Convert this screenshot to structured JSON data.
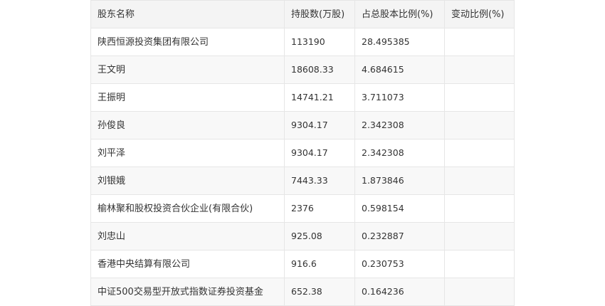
{
  "table": {
    "headers": [
      "股东名称",
      "持股数(万股)",
      "占总股本比例(%)",
      "变动比例(%)"
    ],
    "rows": [
      [
        "陕西恒源投资集团有限公司",
        "113190",
        "28.495385",
        ""
      ],
      [
        "王文明",
        "18608.33",
        "4.684615",
        ""
      ],
      [
        "王振明",
        "14741.21",
        "3.711073",
        ""
      ],
      [
        "孙俊良",
        "9304.17",
        "2.342308",
        ""
      ],
      [
        "刘平泽",
        "9304.17",
        "2.342308",
        ""
      ],
      [
        "刘银娥",
        "7443.33",
        "1.873846",
        ""
      ],
      [
        "榆林聚和股权投资合伙企业(有限合伙)",
        "2376",
        "0.598154",
        ""
      ],
      [
        "刘忠山",
        "925.08",
        "0.232887",
        ""
      ],
      [
        "香港中央结算有限公司",
        "916.6",
        "0.230753",
        ""
      ],
      [
        "中证500交易型开放式指数证券投资基金",
        "652.38",
        "0.164236",
        ""
      ]
    ]
  }
}
